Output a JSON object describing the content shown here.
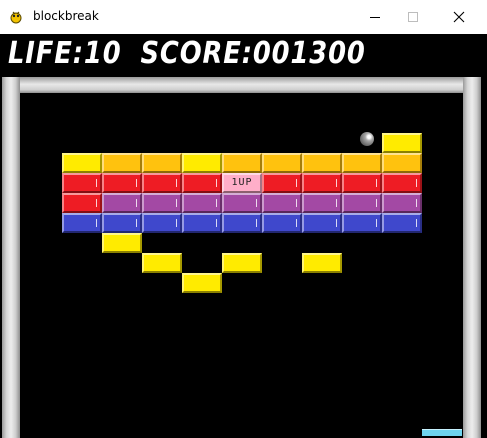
{
  "window": {
    "title": "blockbreak",
    "icon": "pygame-snake-icon",
    "buttons": [
      "minimize-icon",
      "maximize-icon",
      "close-icon"
    ]
  },
  "hud": {
    "life_label": "LIFE:",
    "life_value": "10",
    "score_label": "SCORE:",
    "score_value": "001300"
  },
  "colors": {
    "yellow": "#ffeb00",
    "gold": "#ffc20e",
    "red": "#ee1c24",
    "purple": "#a349a4",
    "blue": "#3f48cc",
    "powerup": "#ffaec9",
    "paddle": "#6fd4ee"
  },
  "powerup_label": "1UP"
}
